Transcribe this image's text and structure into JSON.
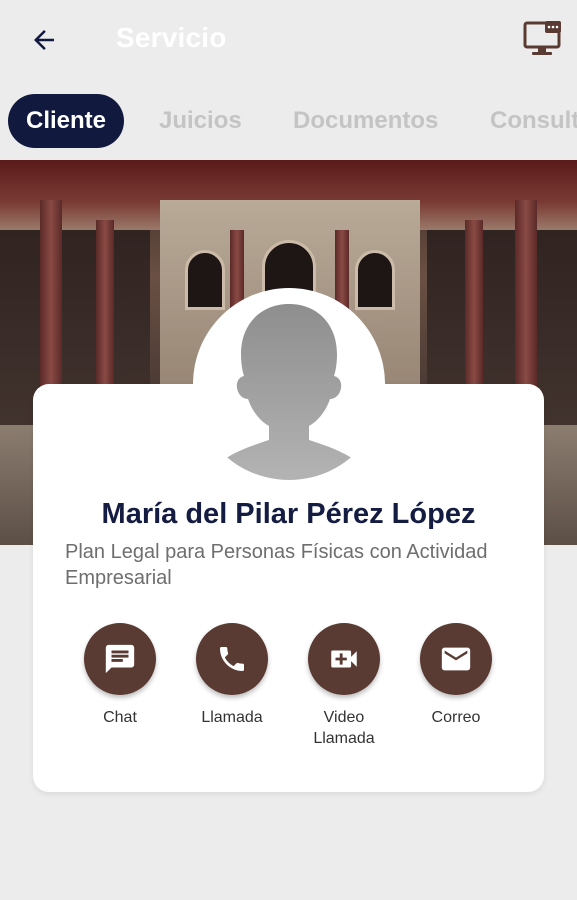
{
  "header": {
    "title": "Servicio",
    "back_icon": "arrow-left-icon",
    "right_icon": "monitor-chat-icon"
  },
  "tabs": [
    {
      "label": "Cliente",
      "active": true
    },
    {
      "label": "Juicios",
      "active": false
    },
    {
      "label": "Documentos",
      "active": false
    },
    {
      "label": "Consultas",
      "active": false
    }
  ],
  "client": {
    "name": "María del Pilar Pérez López",
    "plan": "Plan Legal para Personas Físicas con Actividad Empresarial"
  },
  "actions": [
    {
      "label": "Chat",
      "icon": "chat-icon"
    },
    {
      "label": "Llamada",
      "icon": "phone-icon"
    },
    {
      "label": "Video\nLlamada",
      "icon": "video-call-icon"
    },
    {
      "label": "Correo",
      "icon": "mail-icon"
    }
  ],
  "colors": {
    "tab_active_bg": "#111a3e",
    "name_color": "#141c42",
    "action_bg": "#5a3b33",
    "background": "#ececec"
  }
}
